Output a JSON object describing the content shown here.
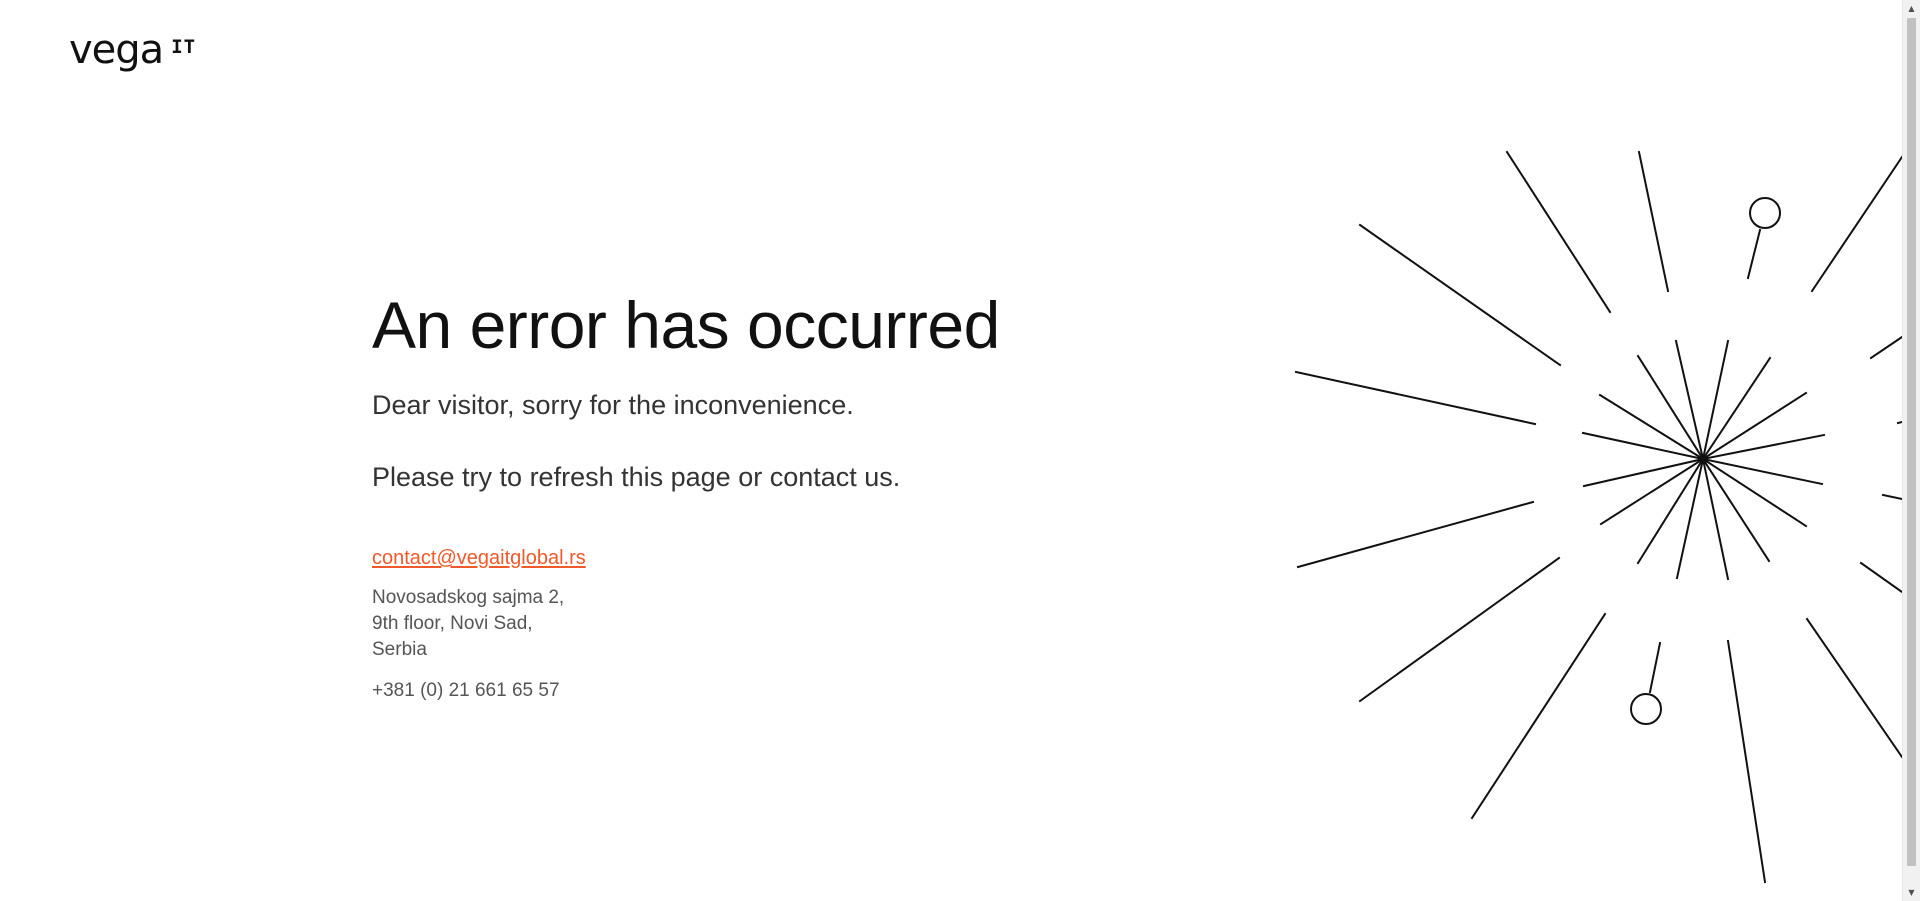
{
  "logo": {
    "word": "vega",
    "sup": "IT"
  },
  "main": {
    "title": "An error has occurred",
    "line1": "Dear visitor, sorry for the inconvenience.",
    "line2": "Please try to refresh this page or contact us."
  },
  "contact": {
    "email": "contact@vegaitglobal.rs",
    "address_lines": [
      "Novosadskog sajma 2,",
      "9th floor, Novi Sad,",
      "Serbia"
    ],
    "phone": "+381 (0) 21 661 65 57"
  },
  "colors": {
    "accent": "#f0592a",
    "text": "#111111",
    "muted": "#555555"
  },
  "icons": {
    "scroll_up": "triangle-up",
    "scroll_down": "triangle-down"
  }
}
